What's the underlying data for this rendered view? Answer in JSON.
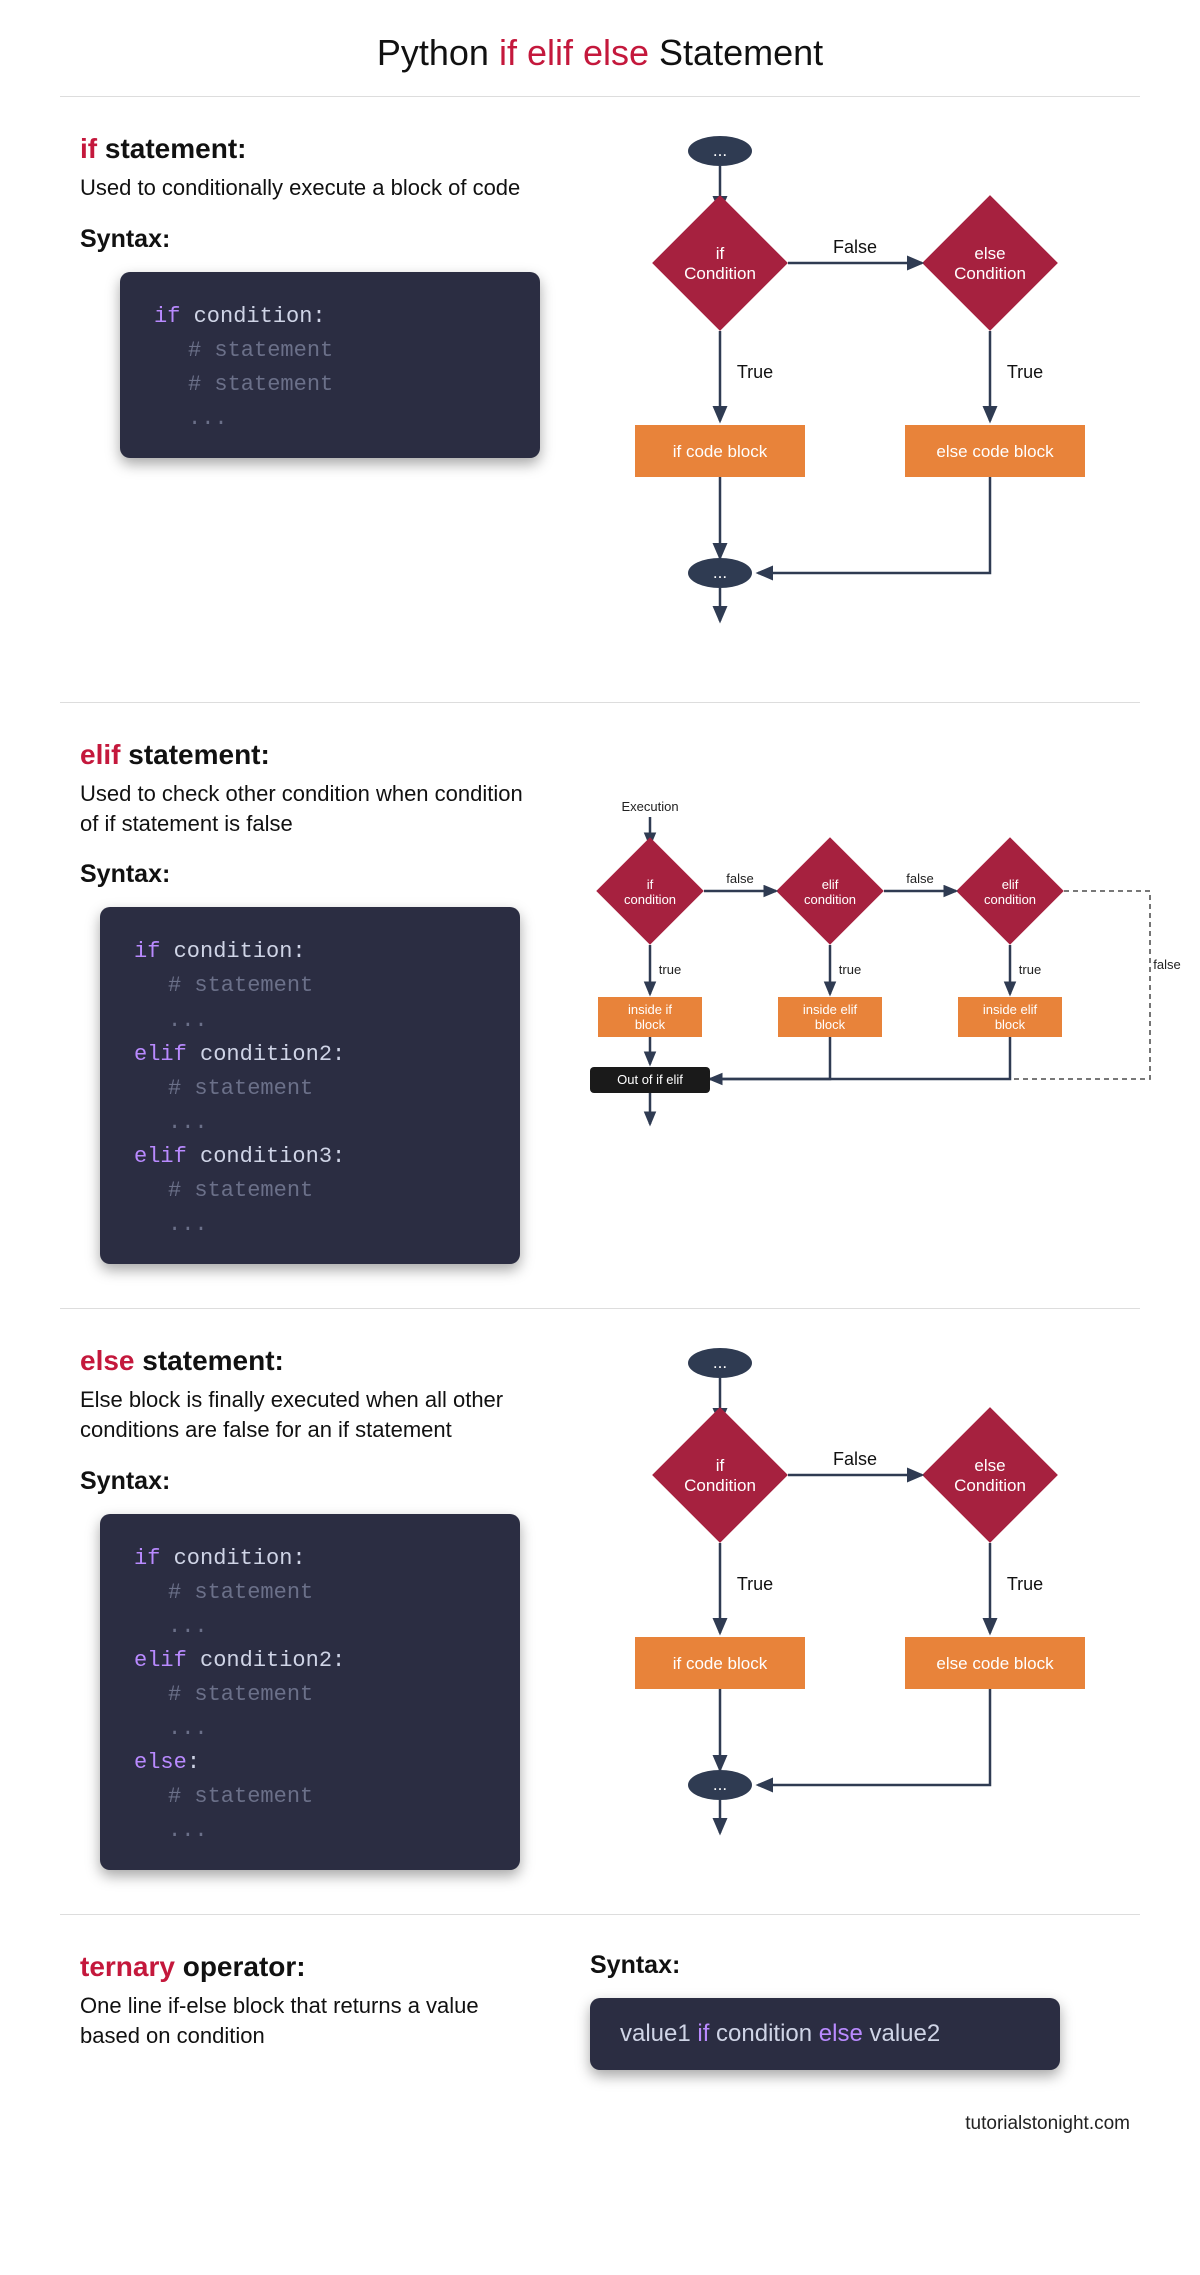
{
  "page": {
    "title_pre": "Python ",
    "title_kw": "if elif else",
    "title_post": " Statement",
    "footer": "tutorialstonight.com"
  },
  "colors": {
    "keyword_red": "#c4183c",
    "code_bg": "#2b2d42",
    "code_purple": "#b98aff",
    "diamond": "#a6213f",
    "block": "#e8833a",
    "pill": "#2f3b52"
  },
  "sections": {
    "if": {
      "heading_kw": "if",
      "heading_rest": " statement:",
      "desc": "Used to conditionally execute a block of code",
      "syntax_label": "Syntax:",
      "code": {
        "l1_kw": "if",
        "l1_id": " condition:",
        "l2_cm": "# statement",
        "l3_cm": "# statement",
        "l4_cm": "..."
      }
    },
    "elif": {
      "heading_kw": "elif",
      "heading_rest": " statement:",
      "desc": "Used to check other condition when condition of if statement is false",
      "syntax_label": "Syntax:",
      "code": {
        "l1_kw": "if",
        "l1_id": " condition:",
        "l2": "# statement",
        "l3": "...",
        "l4_kw": "elif",
        "l4_id": " condition2:",
        "l5": "# statement",
        "l6": "...",
        "l7_kw": "elif",
        "l7_id": " condition3:",
        "l8": "# statement",
        "l9": "..."
      }
    },
    "else": {
      "heading_kw": "else",
      "heading_rest": " statement:",
      "desc": "Else block is finally executed when all other conditions are false for an if statement",
      "syntax_label": "Syntax:",
      "code": {
        "l1_kw": "if",
        "l1_id": " condition:",
        "l2": "# statement",
        "l3": "...",
        "l4_kw": "elif",
        "l4_id": " condition2:",
        "l5": "# statement",
        "l6": "...",
        "l7_kw": "else",
        "l7_id": ":",
        "l8": "# statement",
        "l9": "..."
      }
    },
    "ternary": {
      "heading_kw": "ternary",
      "heading_rest": " operator:",
      "desc": "One line if-else block that returns a value based on condition",
      "syntax_label": "Syntax:",
      "code": {
        "v1": "value1 ",
        "if": "if",
        "cond": " condition ",
        "else": "else",
        "v2": " value2"
      }
    }
  },
  "flow": {
    "if_else": {
      "if_diamond_l1": "if",
      "if_diamond_l2": "Condition",
      "else_diamond_l1": "else",
      "else_diamond_l2": "Condition",
      "false": "False",
      "true": "True",
      "if_block": "if code block",
      "else_block": "else code block",
      "dots": "..."
    },
    "elif": {
      "exec": "Execution",
      "d1_l1": "if",
      "d1_l2": "condition",
      "d2_l1": "elif",
      "d2_l2": "condition",
      "d3_l1": "elif",
      "d3_l2": "condition",
      "true": "true",
      "false": "false",
      "b1_l1": "inside if",
      "b1_l2": "block",
      "b2_l1": "inside elif",
      "b2_l2": "block",
      "b3_l1": "inside elif",
      "b3_l2": "block",
      "out": "Out of if elif"
    }
  }
}
